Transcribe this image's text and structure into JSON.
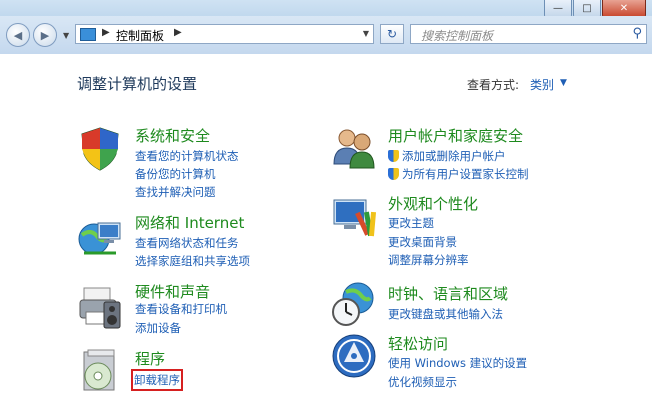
{
  "window": {
    "minimize": "—",
    "maximize": "□",
    "close": "✕"
  },
  "nav": {
    "back": "◀",
    "forward": "▶",
    "address_root_arrow": "▶",
    "address_crumb": "控制面板",
    "address_crumb_arrow": "▶",
    "address_drop": "▼",
    "refresh": "↻",
    "search_placeholder": "搜索控制面板",
    "search_glyph": "⚲"
  },
  "main": {
    "title": "调整计算机的设置",
    "view_by_label": "查看方式:",
    "view_by_value": "类别",
    "view_by_arrow": "▼"
  },
  "categories": {
    "system": {
      "title": "系统和安全",
      "links": [
        "查看您的计算机状态",
        "备份您的计算机",
        "查找并解决问题"
      ]
    },
    "network": {
      "title": "网络和 Internet",
      "links": [
        "查看网络状态和任务",
        "选择家庭组和共享选项"
      ]
    },
    "hardware": {
      "title": "硬件和声音",
      "links": [
        "查看设备和打印机",
        "添加设备"
      ]
    },
    "programs": {
      "title": "程序",
      "links": [
        "卸载程序"
      ]
    },
    "users": {
      "title": "用户帐户和家庭安全",
      "links": [
        "添加或删除用户帐户",
        "为所有用户设置家长控制"
      ]
    },
    "appearance": {
      "title": "外观和个性化",
      "links": [
        "更改主题",
        "更改桌面背景",
        "调整屏幕分辨率"
      ]
    },
    "clock": {
      "title": "时钟、语言和区域",
      "links": [
        "更改键盘或其他输入法"
      ]
    },
    "ease": {
      "title": "轻松访问",
      "links": [
        "使用 Windows 建议的设置",
        "优化视频显示"
      ]
    }
  }
}
